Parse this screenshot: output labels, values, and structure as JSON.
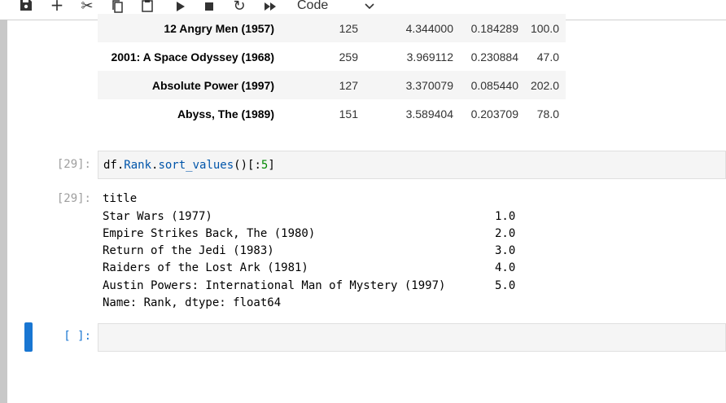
{
  "toolbar": {
    "cell_type": "Code"
  },
  "dataframe": {
    "rows": [
      {
        "title": "12 Angry Men (1957)",
        "c1": "125",
        "c2": "4.344000",
        "c3": "0.184289",
        "c4": "100.0"
      },
      {
        "title": "2001: A Space Odyssey (1968)",
        "c1": "259",
        "c2": "3.969112",
        "c3": "0.230884",
        "c4": "47.0"
      },
      {
        "title": "Absolute Power (1997)",
        "c1": "127",
        "c2": "3.370079",
        "c3": "0.085440",
        "c4": "202.0"
      },
      {
        "title": "Abyss, The (1989)",
        "c1": "151",
        "c2": "3.589404",
        "c3": "0.203709",
        "c4": "78.0"
      }
    ]
  },
  "cell29": {
    "in_prompt": "[29]:",
    "code_prefix": "df.",
    "code_attr": "Rank",
    "code_dot": ".",
    "code_method": "sort_values",
    "code_mid": "()[:",
    "code_num": "5",
    "code_end": "]",
    "out_prompt": "[29]:",
    "output": {
      "header": "title",
      "rows": [
        {
          "title": "Star Wars (1977)",
          "value": "1.0"
        },
        {
          "title": "Empire Strikes Back, The (1980)",
          "value": "2.0"
        },
        {
          "title": "Return of the Jedi (1983)",
          "value": "3.0"
        },
        {
          "title": "Raiders of the Lost Ark (1981)",
          "value": "4.0"
        },
        {
          "title": "Austin Powers: International Man of Mystery (1997)",
          "value": "5.0"
        }
      ],
      "footer": "Name: Rank, dtype: float64"
    }
  },
  "empty_cell": {
    "prompt": "[ ]:"
  }
}
